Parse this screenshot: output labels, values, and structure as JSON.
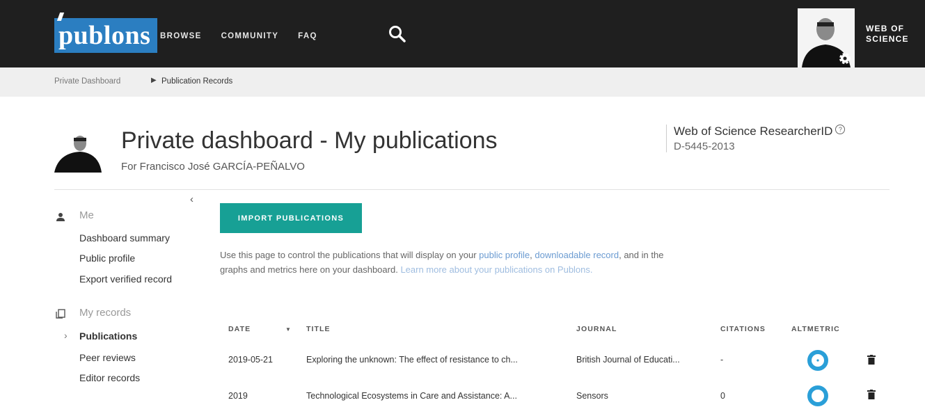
{
  "topbar": {
    "logo_text": "publons",
    "nav": [
      "BROWSE",
      "COMMUNITY",
      "FAQ"
    ],
    "search_icon": "search-icon",
    "wos_label_1": "WEB OF",
    "wos_label_2": "SCIENCE"
  },
  "breadcrumb": {
    "items": [
      "Private Dashboard",
      "Publication Records"
    ]
  },
  "header": {
    "title": "Private dashboard - My publications",
    "subtitle": "For Francisco José GARCÍA-PEÑALVO",
    "rid_label": "Web of Science ResearcherID",
    "rid_value": "D-5445-2013"
  },
  "sidebar": {
    "collapse": "‹",
    "section_me": "Me",
    "me_links": [
      "Dashboard summary",
      "Public profile",
      "Export verified record"
    ],
    "section_records": "My records",
    "records_links": [
      "Publications",
      "Peer reviews",
      "Editor records"
    ]
  },
  "main": {
    "import_label": "IMPORT PUBLICATIONS",
    "desc_1": "Use this page to control the publications that will display on your ",
    "desc_link_1": "public profile",
    "desc_2": ", ",
    "desc_link_2": "downloadable record",
    "desc_3": ", and in the",
    "desc_4": "graphs and metrics here on your dashboard. ",
    "desc_link_3": "Learn more about your publications on Publons."
  },
  "table": {
    "headers": [
      "DATE",
      "TITLE",
      "JOURNAL",
      "CITATIONS",
      "ALTMETRIC"
    ],
    "sort_indicator": "▼",
    "rows": [
      {
        "date": "2019-05-21",
        "title": "Exploring the unknown: The effect of resistance to ch...",
        "journal": "British Journal of Educati...",
        "citations": "-"
      },
      {
        "date": "2019",
        "title": "Technological Ecosystems in Care and Assistance: A...",
        "journal": "Sensors",
        "citations": "0"
      }
    ]
  },
  "colors": {
    "topbar": "#1f1f1f",
    "logo": "#2b7ec1",
    "accent": "#17a095",
    "link": "#6b9bd1",
    "altmetric": "#2a9fd8"
  }
}
